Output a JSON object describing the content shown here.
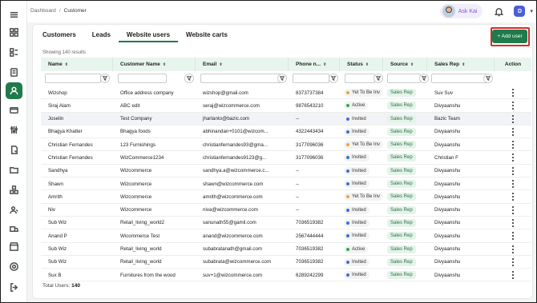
{
  "breadcrumb": {
    "root": "Dashboard",
    "separator": "/",
    "current": "Customer"
  },
  "user": {
    "assistant_label": "Ask Kai",
    "initial": "D"
  },
  "tabs": [
    {
      "label": "Customers",
      "active": false
    },
    {
      "label": "Leads",
      "active": false
    },
    {
      "label": "Website users",
      "active": true
    },
    {
      "label": "Website carts",
      "active": false
    }
  ],
  "add_user_label": "+ Add user",
  "results_text": "Showing 140 results",
  "columns": [
    "Name",
    "Customer Name",
    "Email",
    "Phone n...",
    "Status",
    "Source",
    "Sales Rep",
    "Action"
  ],
  "status_colors": {
    "Yet To Be Inv": "#e8a83a",
    "Active": "#34a853",
    "Invited": "#3b6fd8"
  },
  "rows": [
    {
      "name": "Wizshop",
      "customer": "Office address company",
      "email": "wizshop@gmail.com",
      "phone": "8373737384",
      "status": "Yet To Be Inv",
      "source": "Sales Rep",
      "rep": "Suv Suv"
    },
    {
      "name": "Siraj Alam",
      "customer": "ABC edit",
      "email": "seraj@wizcommerce.com",
      "phone": "9876543210",
      "status": "Active",
      "source": "Sales Rep",
      "rep": "Divyaanshu"
    },
    {
      "name": "Joselin",
      "customer": "Test Company",
      "email": "jhartanto@bazic.com",
      "phone": "--",
      "status": "Invited",
      "source": "Sales Rep",
      "rep": "Bazic Team"
    },
    {
      "name": "Bhagya Khatter",
      "customer": "Bhagya foods",
      "email": "abhinandan+0101@wizcom...",
      "phone": "4322443434",
      "status": "Invited",
      "source": "Sales Rep",
      "rep": "Divyaanshu"
    },
    {
      "name": "Christian Fernandes",
      "customer": "123 Furnishings",
      "email": "christianfernandes93@gma...",
      "phone": "3177096036",
      "status": "Yet To Be Inv",
      "source": "Sales Rep",
      "rep": "Divyaanshu"
    },
    {
      "name": "Christian Fernandes",
      "customer": "WizCommerce1234",
      "email": "christianfernandes9123@g...",
      "phone": "3177096036",
      "status": "Invited",
      "source": "Sales Rep",
      "rep": "Christian F"
    },
    {
      "name": "Sandhya",
      "customer": "Wizcommerce",
      "email": "sandhya.a@wizcommerce.c...",
      "phone": "--",
      "status": "Invited",
      "source": "Sales Rep",
      "rep": "Divyaanshu"
    },
    {
      "name": "Shawn",
      "customer": "Wizcommerce",
      "email": "shawn@wizcommerce.com",
      "phone": "--",
      "status": "Invited",
      "source": "Sales Rep",
      "rep": "Divyaanshu"
    },
    {
      "name": "Amrith",
      "customer": "Wizcommerce",
      "email": "amrith@wizcommerce.com",
      "phone": "--",
      "status": "Yet To Be Inv",
      "source": "Sales Rep",
      "rep": "Divyaanshu"
    },
    {
      "name": "Niv",
      "customer": "Wizcommerce",
      "email": "niva@wizcommerce.com",
      "phone": "--",
      "status": "Invited",
      "source": "Sales Rep",
      "rep": "Divyaanshu"
    },
    {
      "name": "Sub Wiz",
      "customer": "Retail_living_world2",
      "email": "sanunath55@gamil.com",
      "phone": "7036519382",
      "status": "Invited",
      "source": "Sales Rep",
      "rep": "Divyaanshu"
    },
    {
      "name": "Anand P",
      "customer": "Wicommerce Test",
      "email": "anand@wizcommerce.com",
      "phone": "2567444444",
      "status": "Invited",
      "source": "Sales Rep",
      "rep": "Divyaanshu"
    },
    {
      "name": "Sub Wiz",
      "customer": "Retail_living_world",
      "email": "subabratanath@gmail.com",
      "phone": "7036519382",
      "status": "Active",
      "source": "Sales Rep",
      "rep": "Divyaanshu"
    },
    {
      "name": "Sub Wiz",
      "customer": "Retail_living_world",
      "email": "subabrata@wizcommerce.com",
      "phone": "7036519382",
      "status": "Invited",
      "source": "Sales Rep",
      "rep": "Divyaanshu"
    },
    {
      "name": "Sux B",
      "customer": "Furnitures from the wood",
      "email": "suv+1@wizcommerce.com",
      "phone": "6289242299",
      "status": "Invited",
      "source": "Sales Rep",
      "rep": "Divyaanshu"
    }
  ],
  "footer": {
    "label": "Total Users:",
    "count": "140"
  }
}
